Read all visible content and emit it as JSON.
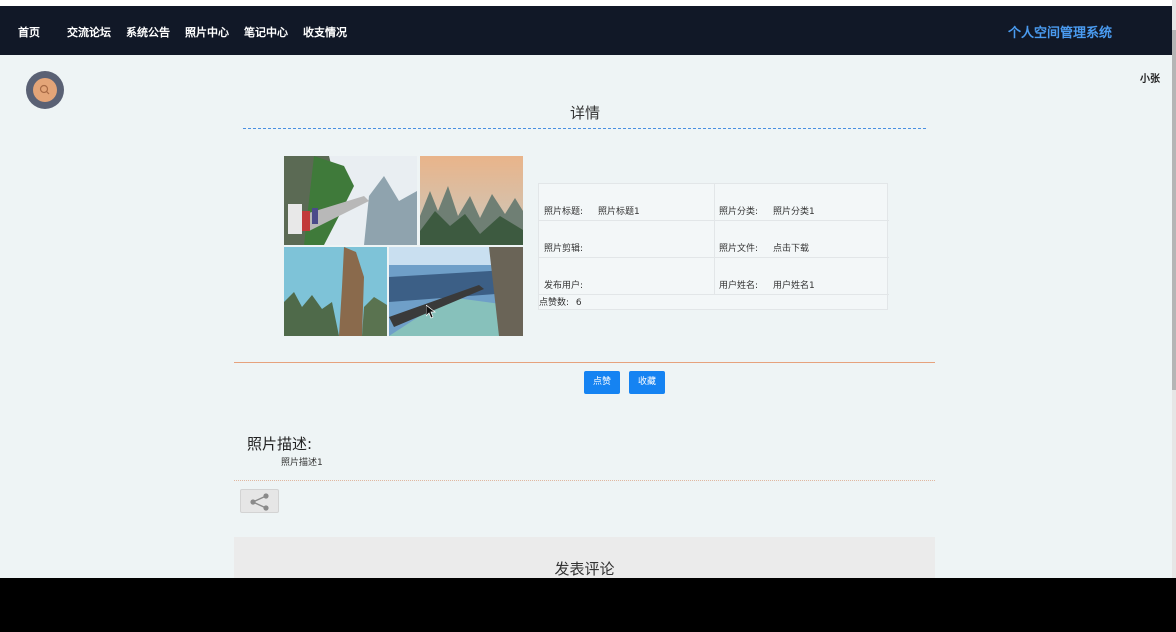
{
  "nav": {
    "items": [
      "首页",
      "交流论坛",
      "系统公告",
      "照片中心",
      "笔记中心",
      "收支情况"
    ],
    "brand": "个人空间管理系统"
  },
  "user": {
    "name": "小张"
  },
  "detail": {
    "title": "详情",
    "fields": {
      "photo_title_label": "照片标题:",
      "photo_title_value": "照片标题1",
      "photo_category_label": "照片分类:",
      "photo_category_value": "照片分类1",
      "photo_edit_label": "照片剪辑:",
      "photo_edit_value": "",
      "photo_file_label": "照片文件:",
      "photo_file_value": "点击下载",
      "publisher_label": "发布用户:",
      "publisher_value": "",
      "user_name_label": "用户姓名:",
      "user_name_value": "用户姓名1",
      "likes_label": "点赞数:",
      "likes_value": "6"
    },
    "buttons": {
      "like": "点赞",
      "favorite": "收藏"
    },
    "description_label": "照片描述:",
    "description_text": "照片描述1"
  },
  "comment": {
    "title": "发表评论"
  },
  "colors": {
    "navbar": "#111827",
    "brand": "#4a9bf0",
    "button": "#1583f2",
    "accent_line": "#e6a27d"
  }
}
